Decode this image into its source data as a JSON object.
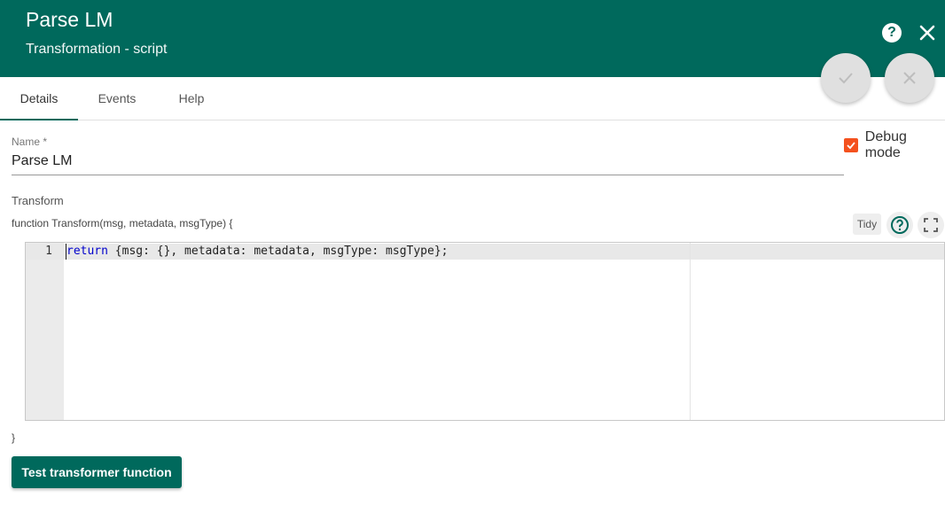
{
  "header": {
    "title": "Parse LM",
    "subtitle": "Transformation - script",
    "help_icon": "help-circle-icon",
    "close_icon": "close-icon",
    "background_color": "#00695c"
  },
  "actions": {
    "apply_icon": "check-icon",
    "cancel_icon": "close-icon"
  },
  "tabs": [
    {
      "label": "Details",
      "active": true
    },
    {
      "label": "Events",
      "active": false
    },
    {
      "label": "Help",
      "active": false
    }
  ],
  "form": {
    "name_label": "Name *",
    "name_value": "Parse LM",
    "debug_label": "Debug mode",
    "debug_checked": true,
    "transform_label": "Transform",
    "function_signature": "function Transform(msg, metadata, msgType) {",
    "function_close": "}",
    "tidy_label": "Tidy",
    "help_icon": "help-circle-icon",
    "fullscreen_icon": "fullscreen-icon",
    "test_button_label": "Test transformer function",
    "accent_color": "#f4511e"
  },
  "editor": {
    "lines": [
      {
        "number": "1",
        "keyword": "return",
        "rest": " {msg: {}, metadata: metadata, msgType: msgType};"
      }
    ]
  }
}
